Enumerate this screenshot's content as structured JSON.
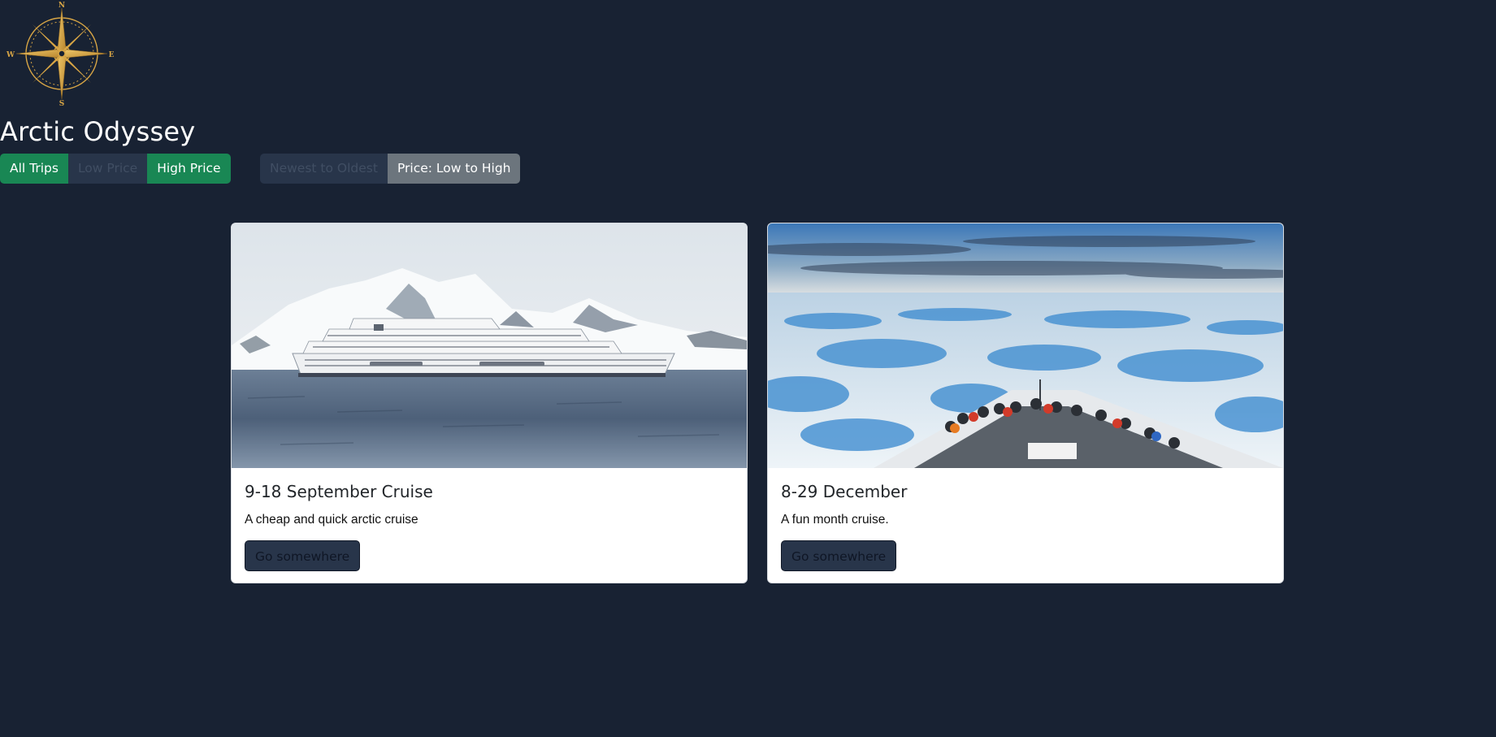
{
  "logo": {
    "icon": "compass-rose-icon",
    "north": "N",
    "south": "S",
    "east": "E",
    "west": "W",
    "color": "#d7a545"
  },
  "page_title": "Arctic Odyssey",
  "filters": {
    "all_trips": "All Trips",
    "low_price": "Low Price",
    "high_price": "High Price"
  },
  "sort": {
    "newest_to_oldest": "Newest to Oldest",
    "price_low_to_high": "Price: Low to High"
  },
  "cards": [
    {
      "image": "cruise-ship-arctic-photo",
      "title": "9-18 September Cruise",
      "text": "A cheap and quick arctic cruise",
      "button": "Go somewhere"
    },
    {
      "image": "icebreaker-bow-pack-ice-photo",
      "title": "8-29 December",
      "text": "A fun month cruise.",
      "button": "Go somewhere"
    }
  ],
  "colors": {
    "background": "#182233",
    "success": "#198754",
    "secondary": "#6c757d",
    "dark_button": "#28354a"
  }
}
